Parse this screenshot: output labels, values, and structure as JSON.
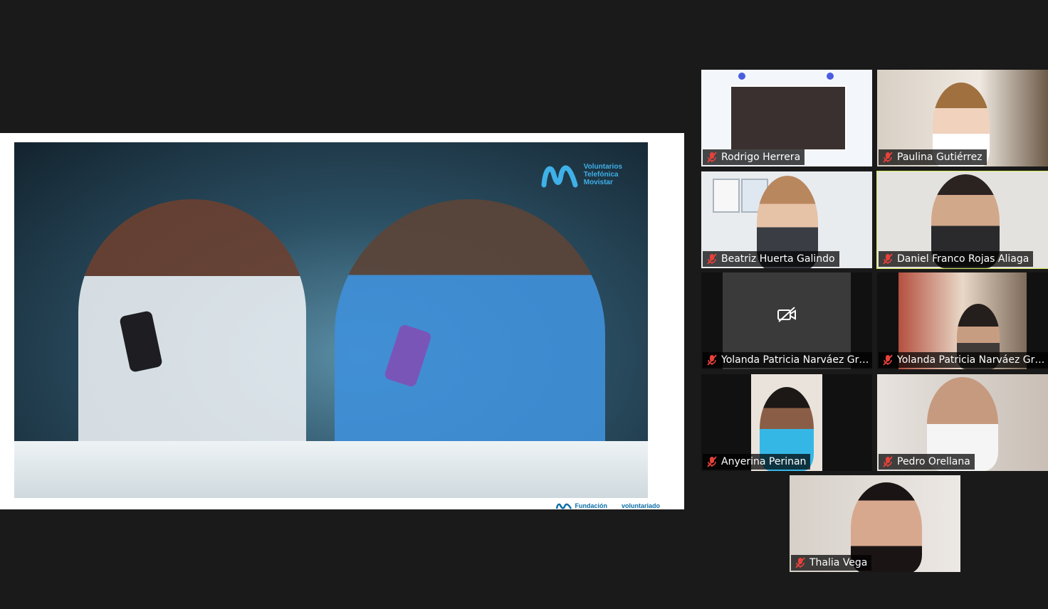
{
  "shared_screen": {
    "brand_lines": [
      "Voluntarios",
      "Telefónica",
      "Movistar"
    ],
    "footer_left": "Fundación",
    "footer_right": "voluntariado",
    "accent": "#3fb0e8"
  },
  "participants": [
    {
      "name": "Rodrigo Herrera",
      "muted": true,
      "active": false,
      "video": "screen"
    },
    {
      "name": "Paulina Gutiérrez",
      "muted": true,
      "active": false,
      "video": "on"
    },
    {
      "name": "Beatriz Huerta Galindo",
      "muted": true,
      "active": false,
      "video": "on"
    },
    {
      "name": "Daniel Franco Rojas Aliaga",
      "muted": true,
      "active": true,
      "video": "on"
    },
    {
      "name": "Yolanda Patricia Narváez Gra...",
      "muted": true,
      "active": false,
      "video": "off"
    },
    {
      "name": "Yolanda Patricia Narváez Gra...",
      "muted": true,
      "active": false,
      "video": "on"
    },
    {
      "name": "Anyerina Perinan",
      "muted": true,
      "active": false,
      "video": "on"
    },
    {
      "name": "Pedro Orellana",
      "muted": true,
      "active": false,
      "video": "on"
    },
    {
      "name": "Thalia Vega",
      "muted": true,
      "active": false,
      "video": "on"
    }
  ],
  "colors": {
    "active_speaker_border": "#d6ea55",
    "muted_icon": "#e8413b",
    "background": "#1a1a1a"
  },
  "icons": {
    "muted": "microphone-muted-icon",
    "video_off": "video-off-icon"
  }
}
